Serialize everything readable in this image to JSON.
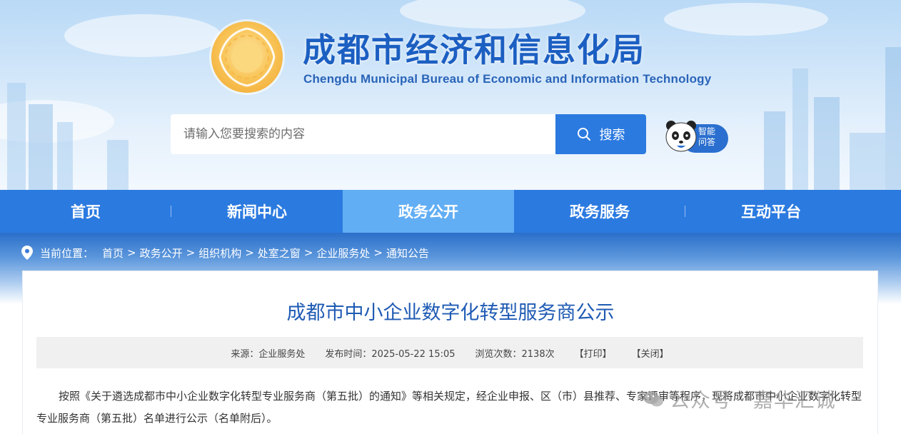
{
  "header": {
    "title": "成都市经济和信息化局",
    "subtitle": "Chengdu Municipal Bureau of Economic and Information Technology"
  },
  "search": {
    "placeholder": "请输入您要搜索的内容",
    "button_label": "搜索"
  },
  "assistant": {
    "label_line1": "智能",
    "label_line2": "问答"
  },
  "nav": {
    "items": [
      {
        "label": "首页"
      },
      {
        "label": "新闻中心"
      },
      {
        "label": "政务公开"
      },
      {
        "label": "政务服务"
      },
      {
        "label": "互动平台"
      }
    ],
    "active": "政务公开"
  },
  "breadcrumb": {
    "prefix": "当前位置：",
    "items": [
      "首页",
      "政务公开",
      "组织机构",
      "处室之窗",
      "企业服务处",
      "通知公告"
    ],
    "separator": ">"
  },
  "article": {
    "title": "成都市中小企业数字化转型服务商公示",
    "meta": {
      "source": "来源：企业服务处",
      "published": "发布时间：2025-05-22 15:05",
      "views": "浏览次数：2138次",
      "print": "【打印】",
      "close": "【关闭】"
    },
    "paragraph": "按照《关于遴选成都市中小企业数字化转型专业服务商（第五批）的通知》等相关规定，经企业申报、区（市）县推荐、专家评审等程序，现将成都市中小企业数字化转型专业服务商（第五批）名单进行公示（名单附后）。"
  },
  "watermark": {
    "text": "公众号 · 嘉华汇诚"
  },
  "colors": {
    "brand_blue": "#2b7ae0",
    "nav_active": "#62aef4",
    "title_blue": "#1f5bb4",
    "logo_gold": "#f0a62e"
  }
}
